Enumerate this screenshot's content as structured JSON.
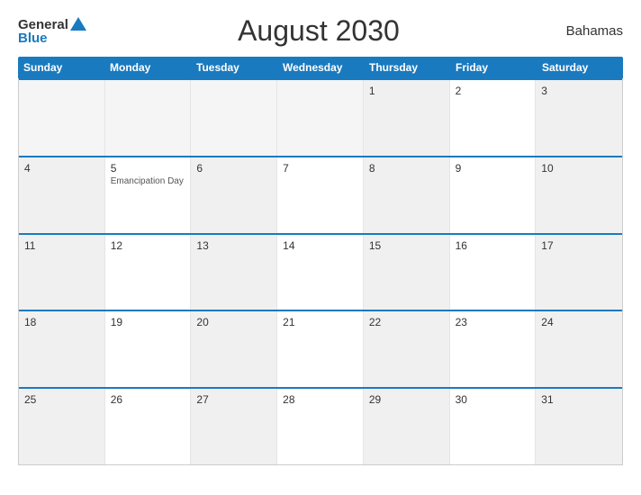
{
  "header": {
    "logo_general": "General",
    "logo_blue": "Blue",
    "title": "August 2030",
    "country": "Bahamas"
  },
  "days": [
    "Sunday",
    "Monday",
    "Tuesday",
    "Wednesday",
    "Thursday",
    "Friday",
    "Saturday"
  ],
  "weeks": [
    [
      {
        "day": "",
        "alt": true,
        "empty": true
      },
      {
        "day": "",
        "alt": false,
        "empty": true
      },
      {
        "day": "",
        "alt": true,
        "empty": true
      },
      {
        "day": "",
        "alt": false,
        "empty": true
      },
      {
        "day": "1",
        "alt": true,
        "empty": false
      },
      {
        "day": "2",
        "alt": false,
        "empty": false
      },
      {
        "day": "3",
        "alt": true,
        "empty": false
      }
    ],
    [
      {
        "day": "4",
        "alt": true,
        "empty": false
      },
      {
        "day": "5",
        "alt": false,
        "empty": false,
        "event": "Emancipation Day"
      },
      {
        "day": "6",
        "alt": true,
        "empty": false
      },
      {
        "day": "7",
        "alt": false,
        "empty": false
      },
      {
        "day": "8",
        "alt": true,
        "empty": false
      },
      {
        "day": "9",
        "alt": false,
        "empty": false
      },
      {
        "day": "10",
        "alt": true,
        "empty": false
      }
    ],
    [
      {
        "day": "11",
        "alt": true,
        "empty": false
      },
      {
        "day": "12",
        "alt": false,
        "empty": false
      },
      {
        "day": "13",
        "alt": true,
        "empty": false
      },
      {
        "day": "14",
        "alt": false,
        "empty": false
      },
      {
        "day": "15",
        "alt": true,
        "empty": false
      },
      {
        "day": "16",
        "alt": false,
        "empty": false
      },
      {
        "day": "17",
        "alt": true,
        "empty": false
      }
    ],
    [
      {
        "day": "18",
        "alt": true,
        "empty": false
      },
      {
        "day": "19",
        "alt": false,
        "empty": false
      },
      {
        "day": "20",
        "alt": true,
        "empty": false
      },
      {
        "day": "21",
        "alt": false,
        "empty": false
      },
      {
        "day": "22",
        "alt": true,
        "empty": false
      },
      {
        "day": "23",
        "alt": false,
        "empty": false
      },
      {
        "day": "24",
        "alt": true,
        "empty": false
      }
    ],
    [
      {
        "day": "25",
        "alt": true,
        "empty": false
      },
      {
        "day": "26",
        "alt": false,
        "empty": false
      },
      {
        "day": "27",
        "alt": true,
        "empty": false
      },
      {
        "day": "28",
        "alt": false,
        "empty": false
      },
      {
        "day": "29",
        "alt": true,
        "empty": false
      },
      {
        "day": "30",
        "alt": false,
        "empty": false
      },
      {
        "day": "31",
        "alt": true,
        "empty": false
      }
    ]
  ]
}
